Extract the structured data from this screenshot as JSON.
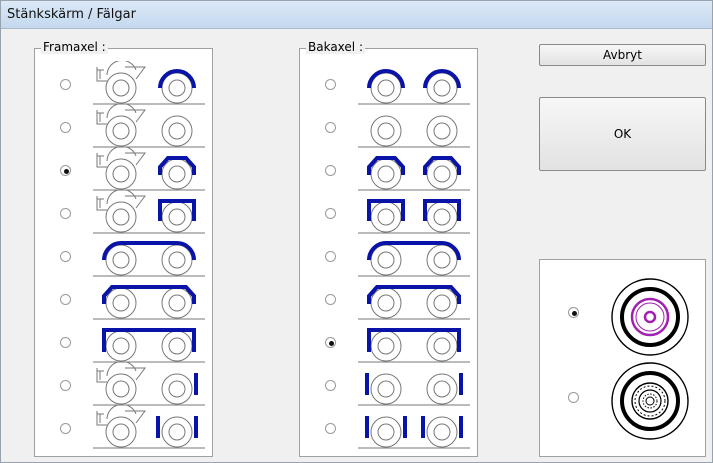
{
  "window": {
    "title": "Stänkskärm / Fälgar"
  },
  "front": {
    "legend": "Framaxel :",
    "selected": 2,
    "rows": [
      {
        "name": "front-option-1",
        "left": "axle-fender",
        "right": "arch"
      },
      {
        "name": "front-option-2",
        "left": "axle-fender",
        "right": "none"
      },
      {
        "name": "front-option-3",
        "left": "axle-fender",
        "right": "arch-flat"
      },
      {
        "name": "front-option-4",
        "left": "axle-fender",
        "right": "square"
      },
      {
        "name": "front-option-5",
        "left": "arch-wide",
        "right": "arch-wide"
      },
      {
        "name": "front-option-6",
        "left": "arch-flat-wide",
        "right": "arch-flat-wide"
      },
      {
        "name": "front-option-7",
        "left": "square-wide",
        "right": "square-wide"
      },
      {
        "name": "front-option-8",
        "left": "axle-fender",
        "right": "flap-right"
      },
      {
        "name": "front-option-9",
        "left": "axle-fender",
        "right": "flaps-both"
      }
    ]
  },
  "rear": {
    "legend": "Bakaxel :",
    "selected": 6,
    "rows": [
      {
        "name": "rear-option-1",
        "left": "arch",
        "right": "arch"
      },
      {
        "name": "rear-option-2",
        "left": "none",
        "right": "none"
      },
      {
        "name": "rear-option-3",
        "left": "arch-flat",
        "right": "arch-flat"
      },
      {
        "name": "rear-option-4",
        "left": "square",
        "right": "square"
      },
      {
        "name": "rear-option-5",
        "left": "arch-wide",
        "right": "arch-wide"
      },
      {
        "name": "rear-option-6",
        "left": "arch-flat-wide",
        "right": "arch-flat-wide"
      },
      {
        "name": "rear-option-7",
        "left": "square-wide",
        "right": "square-wide"
      },
      {
        "name": "rear-option-8",
        "left": "flap-left",
        "right": "flap-right"
      },
      {
        "name": "rear-option-9",
        "left": "flaps-both",
        "right": "flaps-both"
      }
    ]
  },
  "buttons": {
    "cancel": "Avbryt",
    "ok": "OK"
  },
  "rims": {
    "selected": 0,
    "options": [
      "rim-plain-icon",
      "rim-spoked-icon"
    ]
  },
  "colors": {
    "fender": "#0a13a8",
    "rim_accent": "#a020b0"
  }
}
